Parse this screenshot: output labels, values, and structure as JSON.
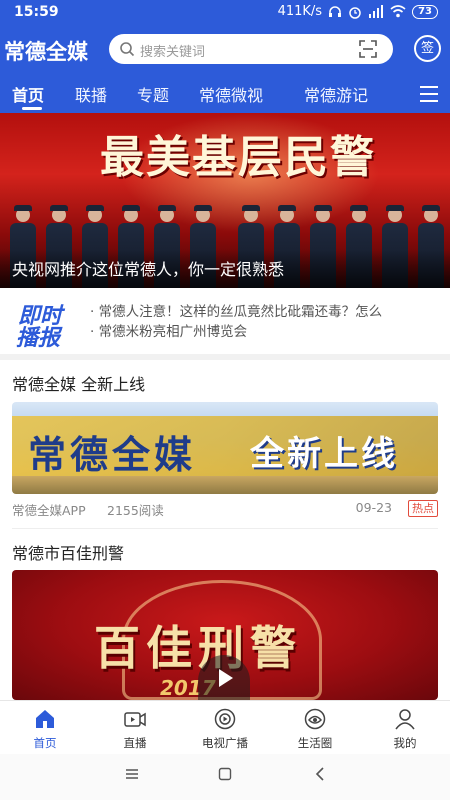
{
  "status_bar": {
    "time": "15:59",
    "speed": "411K/s",
    "battery": "73"
  },
  "app": {
    "logo": "常德全媒",
    "search_placeholder": "搜索关键词",
    "signin_label": "签",
    "accent_color": "#2d5bd9"
  },
  "tabs": [
    {
      "label": "首页",
      "active": true
    },
    {
      "label": "联播",
      "active": false
    },
    {
      "label": "专题",
      "active": false
    },
    {
      "label": "常德微视",
      "active": false
    },
    {
      "label": "常德游记",
      "active": false
    }
  ],
  "hero": {
    "caption": "央视网推介这位常德人，你一定很熟悉",
    "art_text": "最美基层民警"
  },
  "flash_news": {
    "badge_line1": "即时",
    "badge_line2": "播报",
    "items": [
      "· 常德人注意！这样的丝瓜竟然比砒霜还毒？怎么",
      "· 常德米粉亮相广州博览会"
    ]
  },
  "articles": [
    {
      "title": "常德全媒 全新上线",
      "image_text_1": "常德全媒",
      "image_text_2": "全新上线",
      "source": "常德全媒APP",
      "reads": "2155阅读",
      "date": "09-23",
      "tag": "热点"
    },
    {
      "title": "常德市百佳刑警",
      "image_text": "百佳刑警",
      "image_year": "2017"
    }
  ],
  "bottom_nav": [
    {
      "label": "首页",
      "icon": "home-icon",
      "active": true
    },
    {
      "label": "直播",
      "icon": "live-camera-icon",
      "active": false
    },
    {
      "label": "电视广播",
      "icon": "tv-broadcast-icon",
      "active": false
    },
    {
      "label": "生活圈",
      "icon": "life-circle-icon",
      "active": false
    },
    {
      "label": "我的",
      "icon": "user-icon",
      "active": false
    }
  ],
  "system_nav": [
    "menu-icon",
    "home-square-icon",
    "back-icon"
  ]
}
